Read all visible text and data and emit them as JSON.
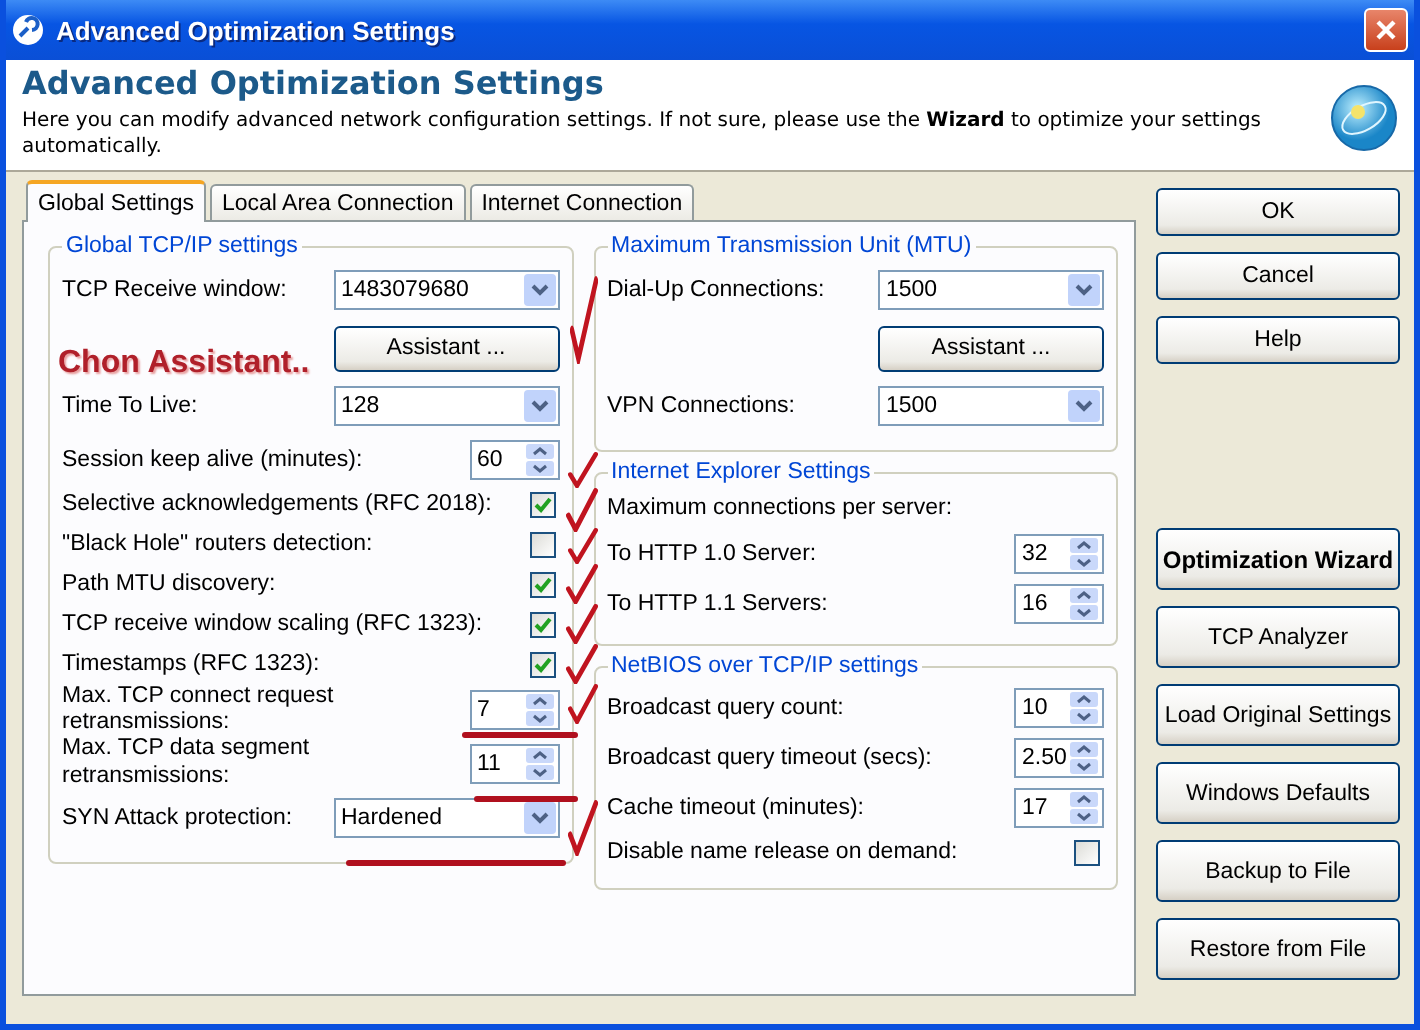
{
  "window": {
    "title": "Advanced Optimization Settings"
  },
  "header": {
    "title": "Advanced Optimization Settings",
    "description": "Here you can modify advanced network configuration settings. If not sure, please use the **Wizard** to optimize your settings automatically."
  },
  "tabs": [
    {
      "label": "Global Settings",
      "selected": true
    },
    {
      "label": "Local Area Connection",
      "selected": false
    },
    {
      "label": "Internet Connection",
      "selected": false
    }
  ],
  "left_groups": [
    {
      "title": "Global TCP/IP settings",
      "rows": [
        {
          "kind": "combo",
          "label": "TCP Receive window:",
          "value": "1483079680"
        },
        {
          "kind": "button",
          "label": "Assistant ..."
        },
        {
          "kind": "combo",
          "label": "Time To Live:",
          "value": "128"
        },
        {
          "kind": "spin",
          "label": "Session keep alive (minutes):",
          "value": "60"
        },
        {
          "kind": "check",
          "label": "Selective acknowledgements (RFC 2018):",
          "checked": true
        },
        {
          "kind": "check",
          "label": "\"Black Hole\" routers detection:",
          "checked": false
        },
        {
          "kind": "check",
          "label": "Path MTU discovery:",
          "checked": true
        },
        {
          "kind": "check",
          "label": "TCP receive window scaling (RFC 1323):",
          "checked": true
        },
        {
          "kind": "check",
          "label": "Timestamps (RFC 1323):",
          "checked": true
        },
        {
          "kind": "spin",
          "label": "Max. TCP connect request retransmissions:",
          "value": "7"
        },
        {
          "kind": "spin",
          "label": "Max. TCP data segment retransmissions:",
          "value": "11"
        },
        {
          "kind": "combo",
          "label": "SYN Attack protection:",
          "value": "Hardened"
        }
      ]
    }
  ],
  "right_groups": [
    {
      "title": "Maximum Transmission Unit (MTU)",
      "rows": [
        {
          "kind": "combo",
          "label": "Dial-Up Connections:",
          "value": "1500"
        },
        {
          "kind": "button",
          "label": "Assistant ..."
        },
        {
          "kind": "combo",
          "label": "VPN Connections:",
          "value": "1500"
        }
      ]
    },
    {
      "title": "Internet Explorer Settings",
      "rows": [
        {
          "kind": "text",
          "label": "Maximum connections per server:"
        },
        {
          "kind": "spin",
          "label": "To HTTP 1.0 Server:",
          "value": "32"
        },
        {
          "kind": "spin",
          "label": "To HTTP 1.1 Servers:",
          "value": "16"
        }
      ]
    },
    {
      "title": "NetBIOS over TCP/IP settings",
      "rows": [
        {
          "kind": "spin",
          "label": "Broadcast query count:",
          "value": "10"
        },
        {
          "kind": "spin",
          "label": "Broadcast query timeout (secs):",
          "value": "2.50"
        },
        {
          "kind": "spin",
          "label": "Cache timeout (minutes):",
          "value": "17"
        },
        {
          "kind": "check",
          "label": "Disable name release on demand:",
          "checked": false
        }
      ]
    }
  ],
  "buttons": [
    {
      "label": "OK",
      "kind": "plain"
    },
    {
      "label": "Cancel",
      "kind": "plain"
    },
    {
      "label": "Help",
      "kind": "plain"
    },
    {
      "label": "Optimization Wizard",
      "kind": "strong"
    },
    {
      "label": "TCP Analyzer",
      "kind": "big"
    },
    {
      "label": "Load Original Settings",
      "kind": "big"
    },
    {
      "label": "Windows Defaults",
      "kind": "big"
    },
    {
      "label": "Backup to File",
      "kind": "big"
    },
    {
      "label": "Restore from File",
      "kind": "big"
    }
  ],
  "annotation": {
    "text": "Chon Assistant.."
  }
}
